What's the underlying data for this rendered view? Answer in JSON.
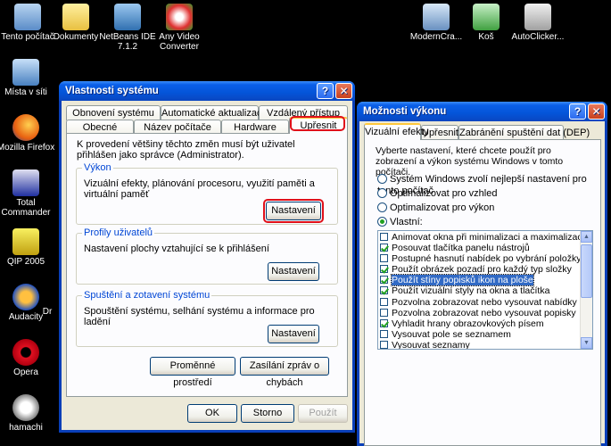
{
  "desktop": {
    "icons": [
      {
        "label": "Tento počítač"
      },
      {
        "label": "Dokumenty"
      },
      {
        "label": "NetBeans IDE 7.1.2"
      },
      {
        "label": "Any Video Converter"
      },
      {
        "label": "ModernCra..."
      },
      {
        "label": "Koš"
      },
      {
        "label": "AutoClicker..."
      },
      {
        "label": "Místa v síti"
      },
      {
        "label": "Mozilla Firefox"
      },
      {
        "label": "Total Commander"
      },
      {
        "label": "QIP 2005"
      },
      {
        "label": "Audacity"
      },
      {
        "label": "Opera"
      },
      {
        "label": "hamachi"
      }
    ],
    "partial_label": "Dr"
  },
  "sysprops": {
    "title": "Vlastnosti systému",
    "tabs_row1": [
      "Obnovení systému",
      "Automatické aktualizace",
      "Vzdálený přístup"
    ],
    "tabs_row2": [
      "Obecné",
      "Název počítače",
      "Hardware",
      "Upřesnit"
    ],
    "intro": "K provedení většiny těchto změn musí být uživatel přihlášen jako správce (Administrator).",
    "perf": {
      "legend": "Výkon",
      "text": "Vizuální efekty, plánování procesoru, využití paměti a virtuální paměť",
      "button": "Nastavení"
    },
    "profiles": {
      "legend": "Profily uživatelů",
      "text": "Nastavení plochy vztahující se k přihlášení",
      "button": "Nastavení"
    },
    "startup": {
      "legend": "Spuštění a zotavení systému",
      "text": "Spouštění systému, selhání systému a informace pro ladění",
      "button": "Nastavení"
    },
    "env_button": "Proměnné prostředí",
    "error_button": "Zasílání zpráv o chybách",
    "ok": "OK",
    "cancel": "Storno",
    "apply": "Použít"
  },
  "perfopts": {
    "title": "Možnosti výkonu",
    "tabs": [
      "Vizuální efekty",
      "Upřesnit",
      "Zabránění spuštění dat (DEP)"
    ],
    "intro": "Vyberte nastavení, které chcete použít pro zobrazení a výkon systému Windows v tomto počítači.",
    "radios": [
      {
        "label": "Systém Windows zvolí nejlepší nastavení pro tento počítač",
        "checked": false
      },
      {
        "label": "Optimalizovat pro vzhled",
        "checked": false
      },
      {
        "label": "Optimalizovat pro výkon",
        "checked": false
      },
      {
        "label": "Vlastní:",
        "checked": true
      }
    ],
    "effects": [
      {
        "label": "Animovat okna při minimalizaci a maximalizaci",
        "checked": false
      },
      {
        "label": "Posouvat tlačítka panelu nástrojů",
        "checked": true
      },
      {
        "label": "Postupné hasnutí nabídek po vybrání položky",
        "checked": false
      },
      {
        "label": "Použít obrázek pozadí pro každý typ složky",
        "checked": true
      },
      {
        "label": "Použít stíny popisků ikon na ploše",
        "checked": true
      },
      {
        "label": "Použít vizuální styly na okna a tlačítka",
        "checked": true
      },
      {
        "label": "Pozvolna zobrazovat nebo vysouvat nabídky",
        "checked": false
      },
      {
        "label": "Pozvolna zobrazovat nebo vysouvat popisky",
        "checked": false
      },
      {
        "label": "Vyhladit hrany obrazovkových písem",
        "checked": true
      },
      {
        "label": "Vysouvat pole se seznamem",
        "checked": false
      },
      {
        "label": "Vysouvat seznamy",
        "checked": false
      }
    ]
  }
}
